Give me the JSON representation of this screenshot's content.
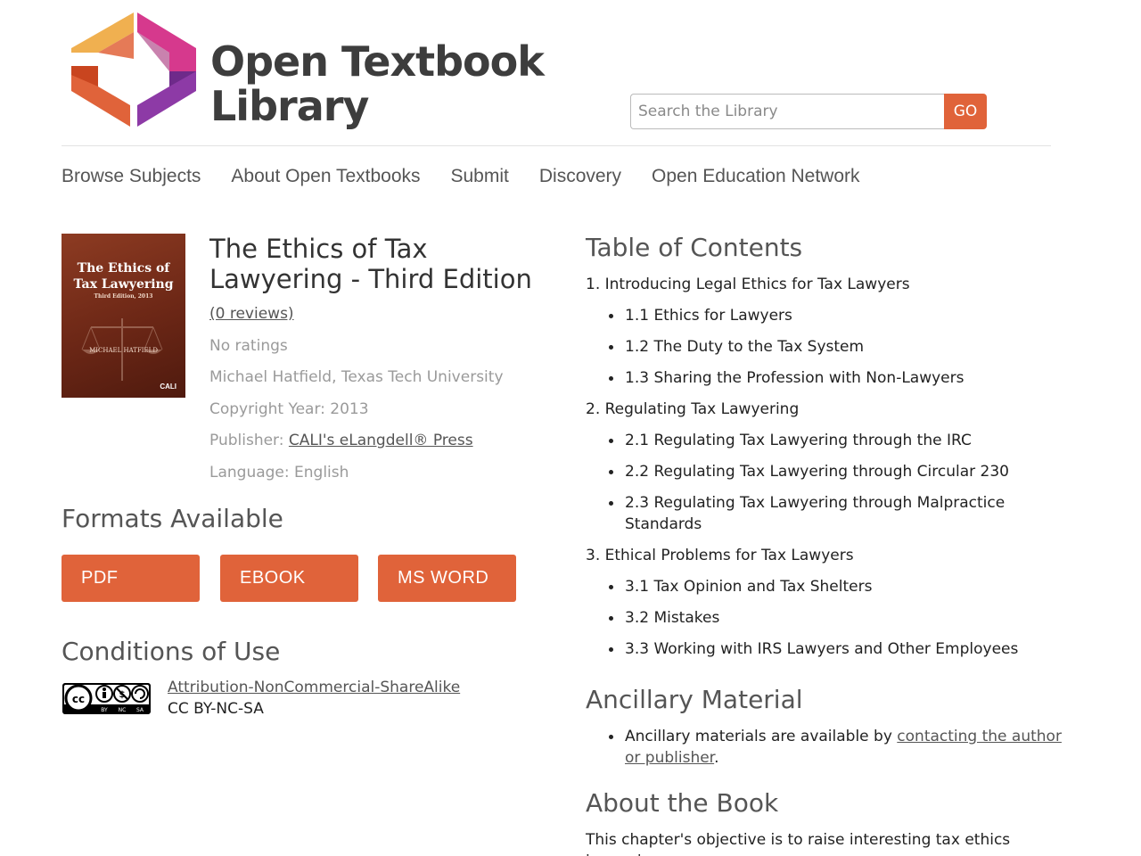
{
  "header": {
    "logo_line1": "Open Textbook",
    "logo_line2": "Library",
    "search_placeholder": "Search the Library",
    "search_button": "GO"
  },
  "nav": {
    "items": [
      "Browse Subjects",
      "About Open Textbooks",
      "Submit",
      "Discovery",
      "Open Education Network"
    ]
  },
  "cover": {
    "title_line1": "The Ethics of",
    "title_line2": "Tax Lawyering",
    "edition": "Third Edition, 2013",
    "author": "MICHAEL HATFIELD",
    "logo": "CALI"
  },
  "book": {
    "title": "The Ethics of Tax Lawyering - Third Edition",
    "reviews": "(0 reviews)",
    "ratings": "No ratings",
    "author": "Michael Hatfield, Texas Tech University",
    "copyright": "Copyright Year: 2013",
    "publisher_label": "Publisher: ",
    "publisher": "CALI's eLangdell® Press",
    "language": "Language: English"
  },
  "formats": {
    "heading": "Formats Available",
    "buttons": [
      "PDF",
      "EBOOK",
      "MS WORD"
    ]
  },
  "conditions": {
    "heading": "Conditions of Use",
    "license_link": "Attribution-NonCommercial-ShareAlike",
    "license_short": "CC BY-NC-SA",
    "badge_labels": [
      "BY",
      "NC",
      "SA"
    ]
  },
  "toc": {
    "heading": "Table of Contents",
    "chapters": [
      {
        "title": "1. Introducing Legal Ethics for Tax Lawyers",
        "sections": [
          "1.1 Ethics for Lawyers",
          "1.2 The Duty to the Tax System",
          "1.3 Sharing the Profession with Non-Lawyers"
        ]
      },
      {
        "title": "2. Regulating Tax Lawyering",
        "sections": [
          "2.1 Regulating Tax Lawyering through the IRC",
          "2.2 Regulating Tax Lawyering through Circular 230",
          "2.3 Regulating Tax Lawyering through Malpractice Standards"
        ]
      },
      {
        "title": "3. Ethical Problems for Tax Lawyers",
        "sections": [
          "3.1 Tax Opinion and Tax Shelters",
          "3.2 Mistakes",
          "3.3 Working with IRS Lawyers and Other Employees"
        ]
      }
    ]
  },
  "ancillary": {
    "heading": "Ancillary Material",
    "text_before": "Ancillary materials are available by ",
    "link": "contacting the author or publisher",
    "text_after": "."
  },
  "about": {
    "heading": "About the Book",
    "text": "This chapter's objective is to raise interesting tax ethics issues in"
  },
  "colors": {
    "accent": "#e0633a",
    "logo_orange": "#f0b050",
    "logo_red": "#e0633a",
    "logo_pink": "#d6398d",
    "logo_purple": "#8d3aa6"
  }
}
